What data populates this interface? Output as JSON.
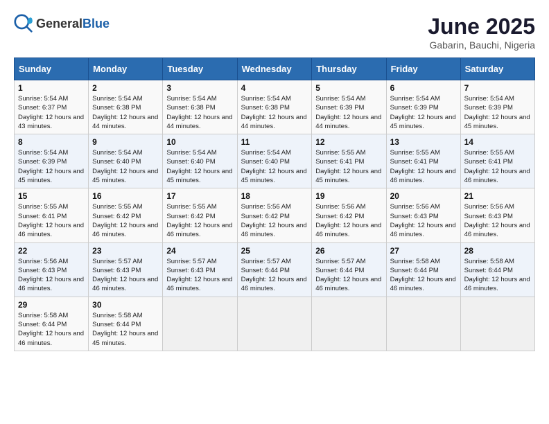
{
  "header": {
    "logo_general": "General",
    "logo_blue": "Blue",
    "month_year": "June 2025",
    "location": "Gabarin, Bauchi, Nigeria"
  },
  "weekdays": [
    "Sunday",
    "Monday",
    "Tuesday",
    "Wednesday",
    "Thursday",
    "Friday",
    "Saturday"
  ],
  "weeks": [
    [
      {
        "day": 1,
        "sunrise": "5:54 AM",
        "sunset": "6:37 PM",
        "daylight": "12 hours and 43 minutes."
      },
      {
        "day": 2,
        "sunrise": "5:54 AM",
        "sunset": "6:38 PM",
        "daylight": "12 hours and 44 minutes."
      },
      {
        "day": 3,
        "sunrise": "5:54 AM",
        "sunset": "6:38 PM",
        "daylight": "12 hours and 44 minutes."
      },
      {
        "day": 4,
        "sunrise": "5:54 AM",
        "sunset": "6:38 PM",
        "daylight": "12 hours and 44 minutes."
      },
      {
        "day": 5,
        "sunrise": "5:54 AM",
        "sunset": "6:39 PM",
        "daylight": "12 hours and 44 minutes."
      },
      {
        "day": 6,
        "sunrise": "5:54 AM",
        "sunset": "6:39 PM",
        "daylight": "12 hours and 45 minutes."
      },
      {
        "day": 7,
        "sunrise": "5:54 AM",
        "sunset": "6:39 PM",
        "daylight": "12 hours and 45 minutes."
      }
    ],
    [
      {
        "day": 8,
        "sunrise": "5:54 AM",
        "sunset": "6:39 PM",
        "daylight": "12 hours and 45 minutes."
      },
      {
        "day": 9,
        "sunrise": "5:54 AM",
        "sunset": "6:40 PM",
        "daylight": "12 hours and 45 minutes."
      },
      {
        "day": 10,
        "sunrise": "5:54 AM",
        "sunset": "6:40 PM",
        "daylight": "12 hours and 45 minutes."
      },
      {
        "day": 11,
        "sunrise": "5:54 AM",
        "sunset": "6:40 PM",
        "daylight": "12 hours and 45 minutes."
      },
      {
        "day": 12,
        "sunrise": "5:55 AM",
        "sunset": "6:41 PM",
        "daylight": "12 hours and 45 minutes."
      },
      {
        "day": 13,
        "sunrise": "5:55 AM",
        "sunset": "6:41 PM",
        "daylight": "12 hours and 46 minutes."
      },
      {
        "day": 14,
        "sunrise": "5:55 AM",
        "sunset": "6:41 PM",
        "daylight": "12 hours and 46 minutes."
      }
    ],
    [
      {
        "day": 15,
        "sunrise": "5:55 AM",
        "sunset": "6:41 PM",
        "daylight": "12 hours and 46 minutes."
      },
      {
        "day": 16,
        "sunrise": "5:55 AM",
        "sunset": "6:42 PM",
        "daylight": "12 hours and 46 minutes."
      },
      {
        "day": 17,
        "sunrise": "5:55 AM",
        "sunset": "6:42 PM",
        "daylight": "12 hours and 46 minutes."
      },
      {
        "day": 18,
        "sunrise": "5:56 AM",
        "sunset": "6:42 PM",
        "daylight": "12 hours and 46 minutes."
      },
      {
        "day": 19,
        "sunrise": "5:56 AM",
        "sunset": "6:42 PM",
        "daylight": "12 hours and 46 minutes."
      },
      {
        "day": 20,
        "sunrise": "5:56 AM",
        "sunset": "6:43 PM",
        "daylight": "12 hours and 46 minutes."
      },
      {
        "day": 21,
        "sunrise": "5:56 AM",
        "sunset": "6:43 PM",
        "daylight": "12 hours and 46 minutes."
      }
    ],
    [
      {
        "day": 22,
        "sunrise": "5:56 AM",
        "sunset": "6:43 PM",
        "daylight": "12 hours and 46 minutes."
      },
      {
        "day": 23,
        "sunrise": "5:57 AM",
        "sunset": "6:43 PM",
        "daylight": "12 hours and 46 minutes."
      },
      {
        "day": 24,
        "sunrise": "5:57 AM",
        "sunset": "6:43 PM",
        "daylight": "12 hours and 46 minutes."
      },
      {
        "day": 25,
        "sunrise": "5:57 AM",
        "sunset": "6:44 PM",
        "daylight": "12 hours and 46 minutes."
      },
      {
        "day": 26,
        "sunrise": "5:57 AM",
        "sunset": "6:44 PM",
        "daylight": "12 hours and 46 minutes."
      },
      {
        "day": 27,
        "sunrise": "5:58 AM",
        "sunset": "6:44 PM",
        "daylight": "12 hours and 46 minutes."
      },
      {
        "day": 28,
        "sunrise": "5:58 AM",
        "sunset": "6:44 PM",
        "daylight": "12 hours and 46 minutes."
      }
    ],
    [
      {
        "day": 29,
        "sunrise": "5:58 AM",
        "sunset": "6:44 PM",
        "daylight": "12 hours and 46 minutes."
      },
      {
        "day": 30,
        "sunrise": "5:58 AM",
        "sunset": "6:44 PM",
        "daylight": "12 hours and 45 minutes."
      },
      null,
      null,
      null,
      null,
      null
    ]
  ]
}
